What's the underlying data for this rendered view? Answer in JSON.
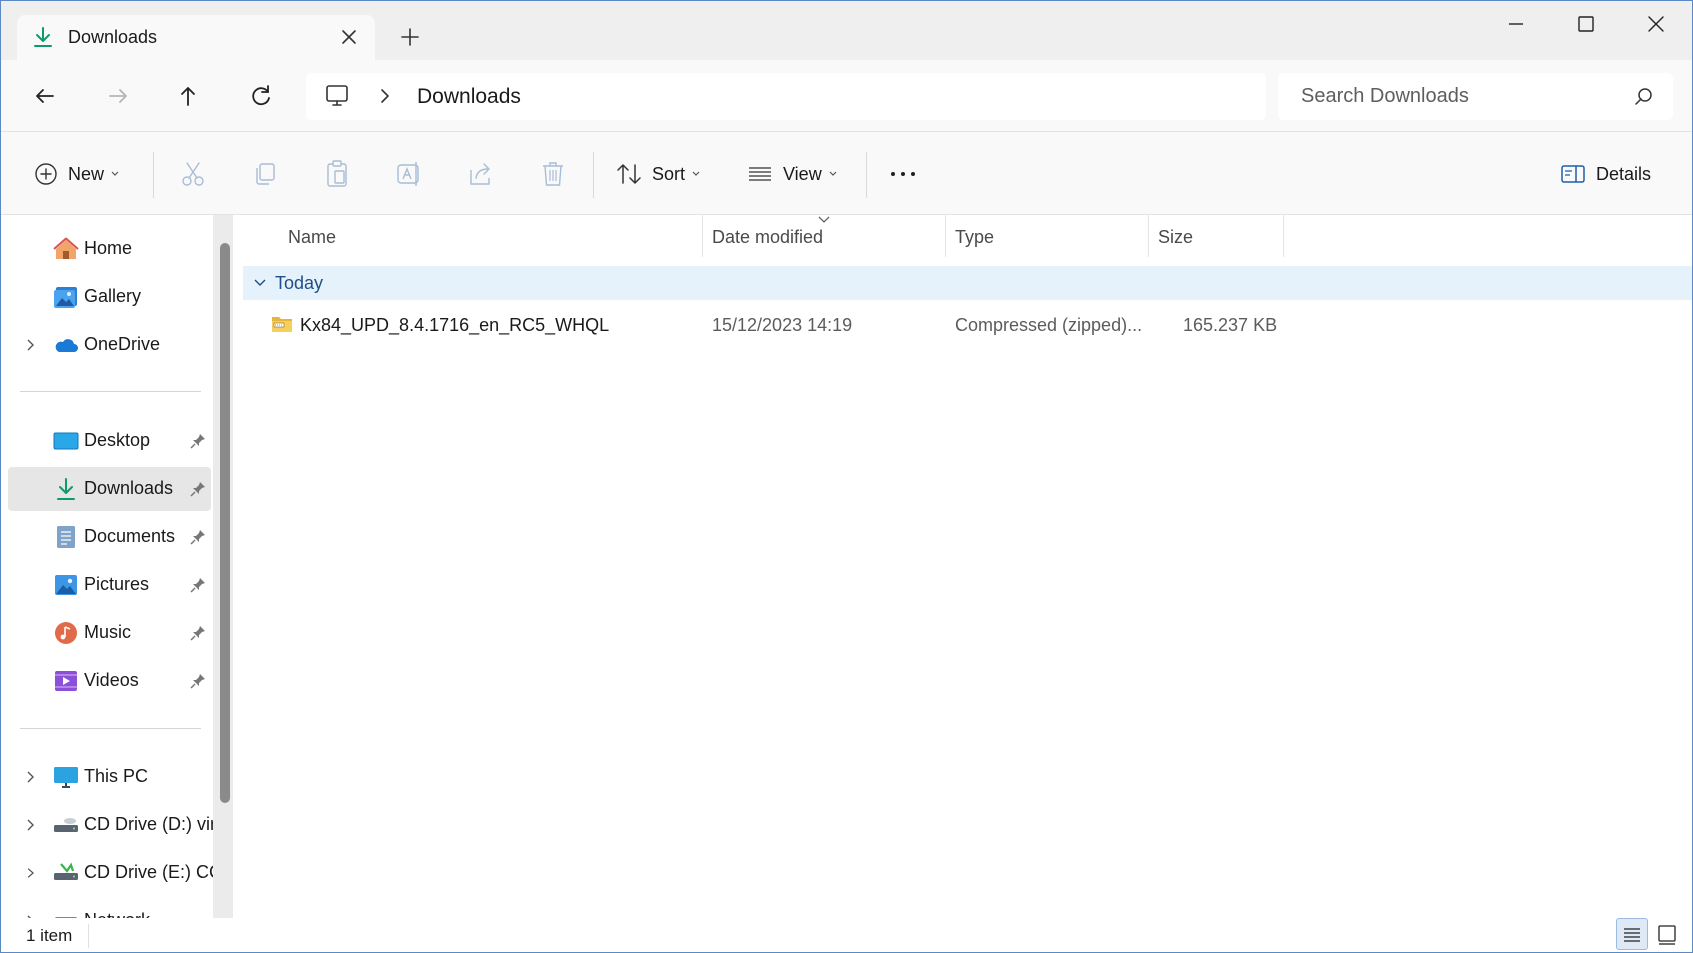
{
  "window": {
    "tab_title": "Downloads"
  },
  "address": {
    "current_folder": "Downloads",
    "search_placeholder": "Search Downloads"
  },
  "toolbar": {
    "new_label": "New",
    "sort_label": "Sort",
    "view_label": "View",
    "details_label": "Details"
  },
  "sidebar": {
    "items": [
      {
        "label": "Home"
      },
      {
        "label": "Gallery"
      },
      {
        "label": "OneDrive"
      },
      {
        "label": "Desktop"
      },
      {
        "label": "Downloads"
      },
      {
        "label": "Documents"
      },
      {
        "label": "Pictures"
      },
      {
        "label": "Music"
      },
      {
        "label": "Videos"
      },
      {
        "label": "This PC"
      },
      {
        "label": "CD Drive (D:) vir"
      },
      {
        "label": "CD Drive (E:) CC("
      },
      {
        "label": "Network"
      }
    ]
  },
  "columns": {
    "name": "Name",
    "date": "Date modified",
    "type": "Type",
    "size": "Size"
  },
  "group": {
    "label": "Today"
  },
  "files": [
    {
      "name": "Kx84_UPD_8.4.1716_en_RC5_WHQL",
      "date": "15/12/2023 14:19",
      "type": "Compressed (zipped)...",
      "size": "165.237 KB"
    }
  ],
  "status": {
    "item_count": "1 item"
  },
  "colors": {
    "accent": "#0067c0",
    "selection": "#e5f1fb",
    "group_text": "#1e4f86"
  }
}
